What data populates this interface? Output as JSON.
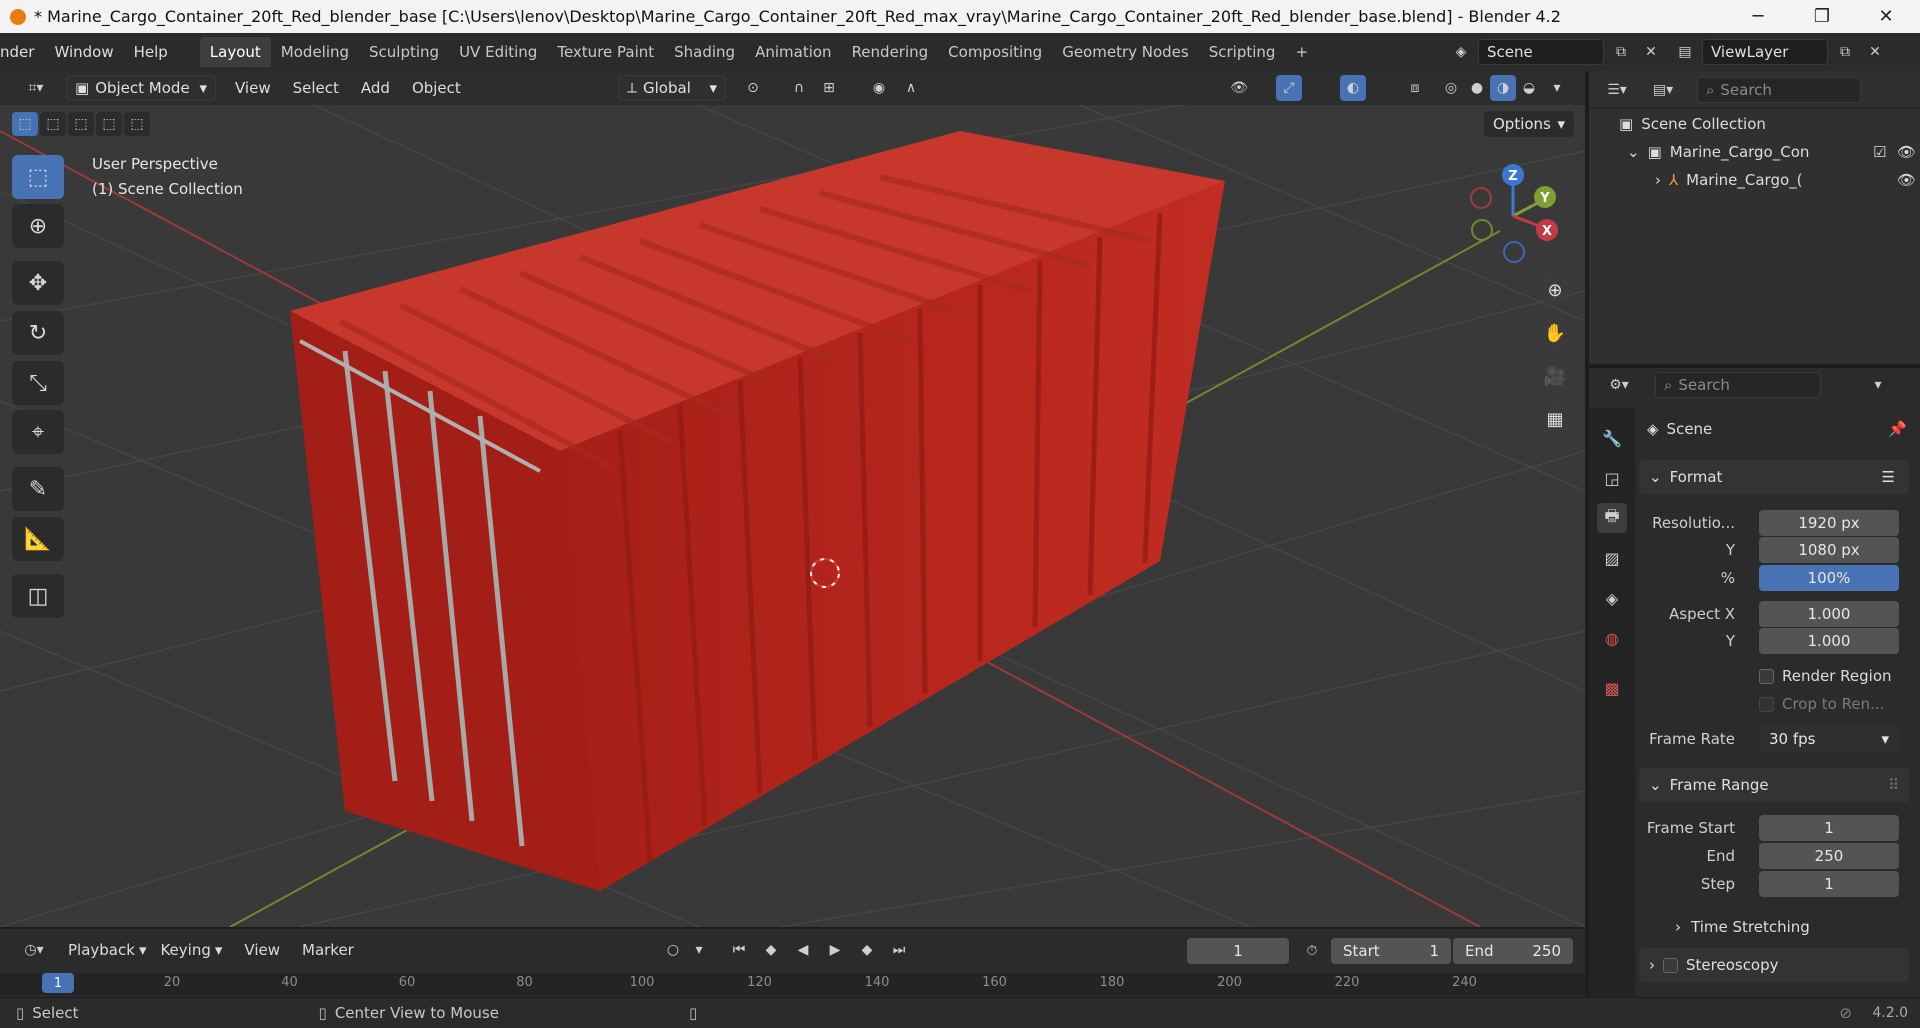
{
  "titlebar": {
    "title": "* Marine_Cargo_Container_20ft_Red_blender_base [C:\\Users\\lenov\\Desktop\\Marine_Cargo_Container_20ft_Red_max_vray\\Marine_Cargo_Container_20ft_Red_blender_base.blend] - Blender 4.2",
    "minimize": "─",
    "maximize": "❐",
    "close": "✕"
  },
  "menu": {
    "render": "nder",
    "window": "Window",
    "help": "Help"
  },
  "workspaces": [
    "Layout",
    "Modeling",
    "Sculpting",
    "UV Editing",
    "Texture Paint",
    "Shading",
    "Animation",
    "Rendering",
    "Compositing",
    "Geometry Nodes",
    "Scripting"
  ],
  "add_workspace": "+",
  "scene_selector": {
    "value": "Scene"
  },
  "viewlayer_selector": {
    "value": "ViewLayer"
  },
  "viewport_header": {
    "mode": "Object Mode",
    "view": "View",
    "select": "Select",
    "add": "Add",
    "object": "Object",
    "transform_orientation": "Global",
    "options": "Options"
  },
  "viewport": {
    "perspective_label": "User Perspective",
    "collection_label": "(1) Scene Collection",
    "gizmo": {
      "z": "Z",
      "y": "Y",
      "x": "X"
    }
  },
  "outliner": {
    "search_placeholder": "Search",
    "items": [
      {
        "label": "Scene Collection"
      },
      {
        "label": "Marine_Cargo_Con"
      },
      {
        "label": "Marine_Cargo_("
      }
    ]
  },
  "properties": {
    "search_placeholder": "Search",
    "context": "Scene",
    "format": {
      "title": "Format",
      "resolution_x_label": "Resolutio...",
      "resolution_x": "1920 px",
      "resolution_y_label": "Y",
      "resolution_y": "1080 px",
      "percent_label": "%",
      "percent": "100%",
      "aspect_x_label": "Aspect X",
      "aspect_x": "1.000",
      "aspect_y_label": "Y",
      "aspect_y": "1.000",
      "render_region": "Render Region",
      "crop": "Crop to Ren...",
      "frame_rate_label": "Frame Rate",
      "frame_rate": "30 fps"
    },
    "frame_range": {
      "title": "Frame Range",
      "start_label": "Frame Start",
      "start": "1",
      "end_label": "End",
      "end": "250",
      "step_label": "Step",
      "step": "1"
    },
    "time_stretching": "Time Stretching",
    "stereoscopy": "Stereoscopy"
  },
  "timeline": {
    "playback": "Playback",
    "keying": "Keying",
    "view": "View",
    "marker": "Marker",
    "current_frame": "1",
    "start_label": "Start",
    "start": "1",
    "end_label": "End",
    "end": "250",
    "ruler": [
      "20",
      "40",
      "60",
      "80",
      "100",
      "120",
      "140",
      "160",
      "180",
      "200",
      "220",
      "240"
    ],
    "playhead": "1"
  },
  "statusbar": {
    "select": "Select",
    "center_view": "Center View to Mouse",
    "version": "4.2.0"
  },
  "colors": {
    "accent": "#4772b3",
    "container_red": "#b8261c",
    "x_axis": "#c33a44",
    "y_axis": "#7ea031",
    "z_axis": "#3a78d6"
  }
}
